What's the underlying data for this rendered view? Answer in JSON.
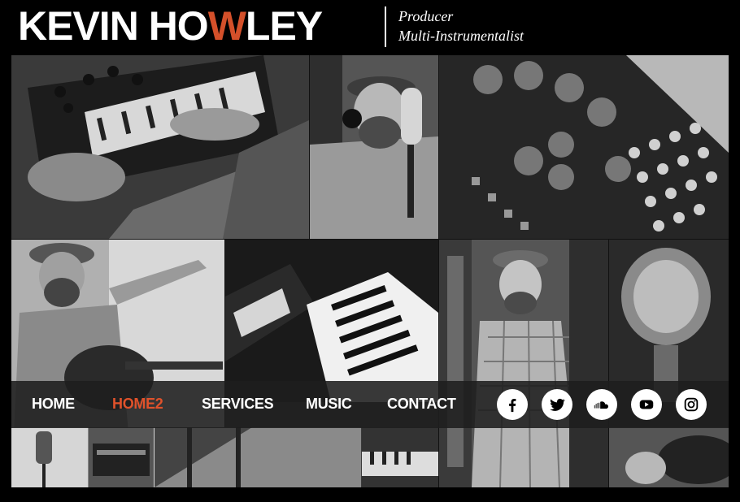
{
  "header": {
    "logo_part1": "KEVIN HO",
    "logo_accent": "W",
    "logo_part2": "LEY",
    "tagline_line1": "Producer",
    "tagline_line2": "Multi-Instrumentalist"
  },
  "nav": {
    "items": [
      {
        "label": "HOME"
      },
      {
        "label": "HOME2"
      },
      {
        "label": "SERVICES"
      },
      {
        "label": "MUSIC"
      },
      {
        "label": "CONTACT"
      }
    ],
    "active": "HOME2"
  },
  "social": [
    {
      "icon": "facebook-icon"
    },
    {
      "icon": "twitter-icon"
    },
    {
      "icon": "soundcloud-icon"
    },
    {
      "icon": "youtube-icon"
    },
    {
      "icon": "instagram-icon"
    }
  ],
  "colors": {
    "accent": "#d4502a",
    "background": "#000000",
    "nav_bg": "#1e1e1e"
  }
}
